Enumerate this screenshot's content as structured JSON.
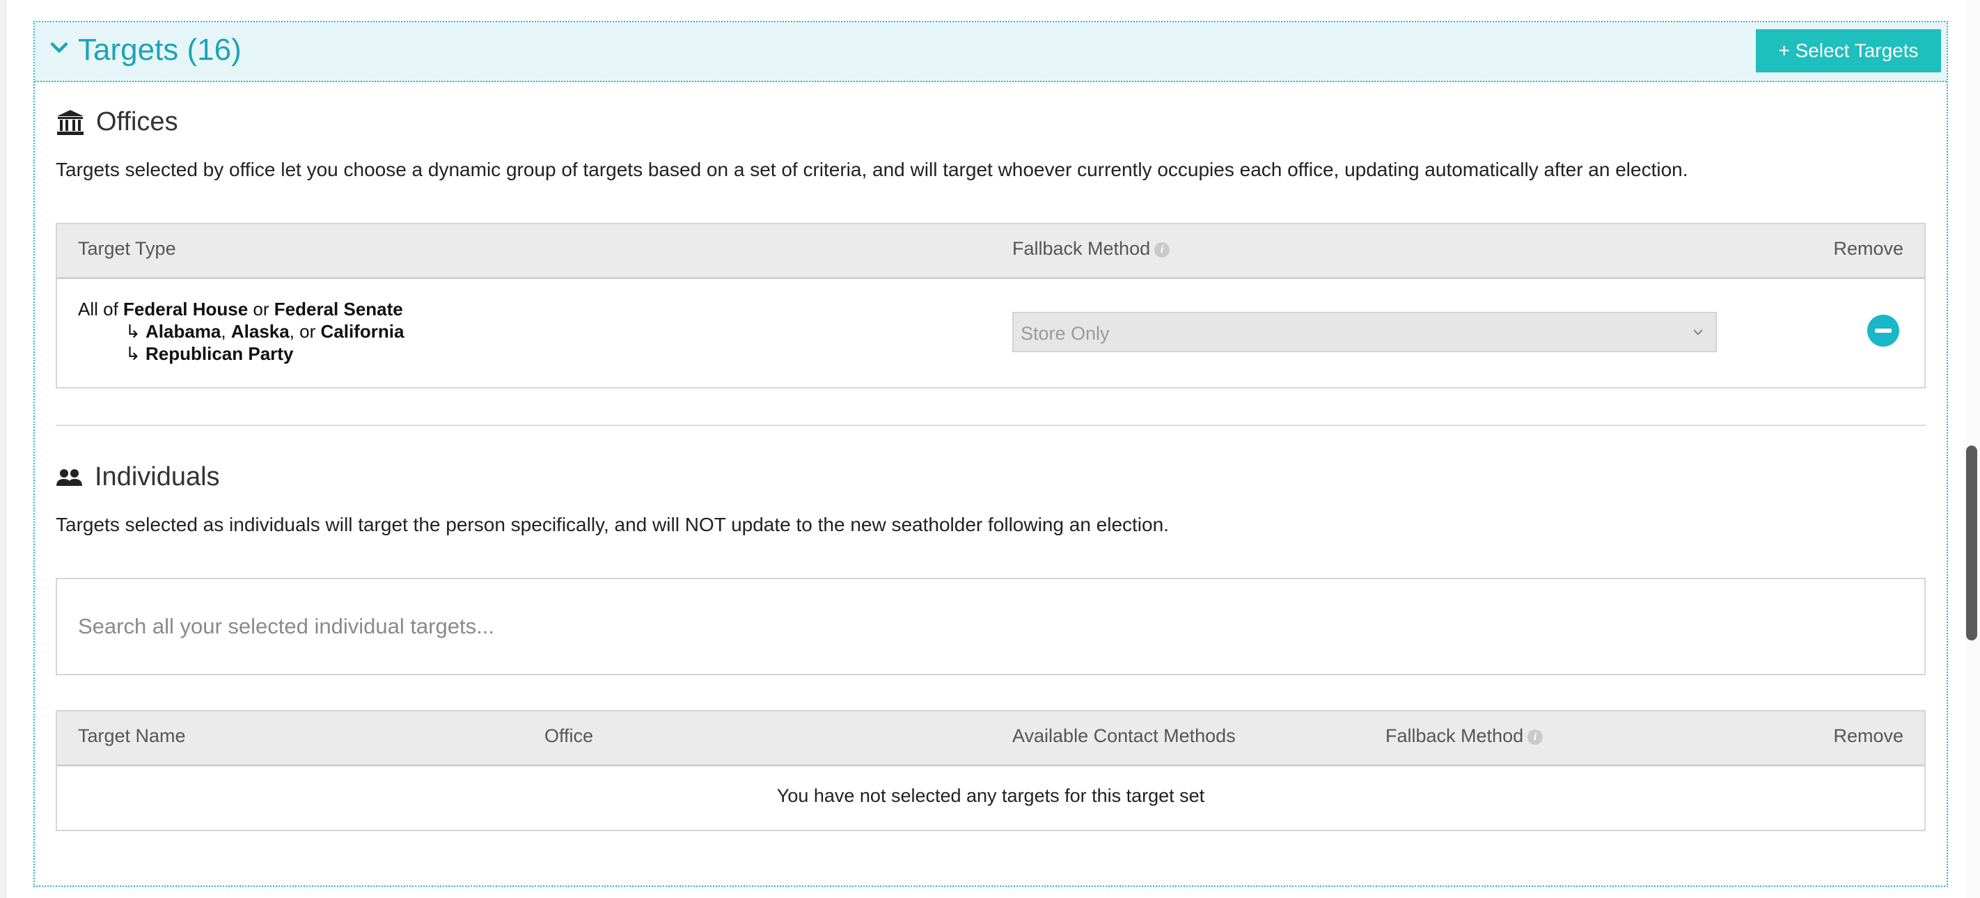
{
  "panel": {
    "title": "Targets (16)",
    "select_button": "+ Select Targets"
  },
  "offices": {
    "title": "Offices",
    "description": "Targets selected by office let you choose a dynamic group of targets based on a set of criteria, and will target whoever currently occupies each office, updating automatically after an election.",
    "columns": {
      "target_type": "Target Type",
      "fallback_method": "Fallback Method",
      "remove": "Remove"
    },
    "row": {
      "line1": {
        "prefix": "All of ",
        "first": "Federal House",
        "or": " or ",
        "second": "Federal Senate"
      },
      "line2": {
        "arrow": "↳ ",
        "a": "Alabama",
        "sep1": ", ",
        "b": "Alaska",
        "sep2": ", or ",
        "c": "California"
      },
      "line3": {
        "arrow": "↳ ",
        "party": "Republican Party"
      },
      "fallback_value": "Store Only"
    }
  },
  "individuals": {
    "title": "Individuals",
    "description": "Targets selected as individuals will target the person specifically, and will NOT update to the new seatholder following an election.",
    "search_placeholder": "Search all your selected individual targets...",
    "columns": {
      "target_name": "Target Name",
      "office": "Office",
      "contact_methods": "Available Contact Methods",
      "fallback_method": "Fallback Method",
      "remove": "Remove"
    },
    "empty_message": "You have not selected any targets for this target set"
  },
  "colors": {
    "accent": "#1fa3b6",
    "button": "#1ebfbd",
    "header_bg": "#e6f6f8"
  }
}
